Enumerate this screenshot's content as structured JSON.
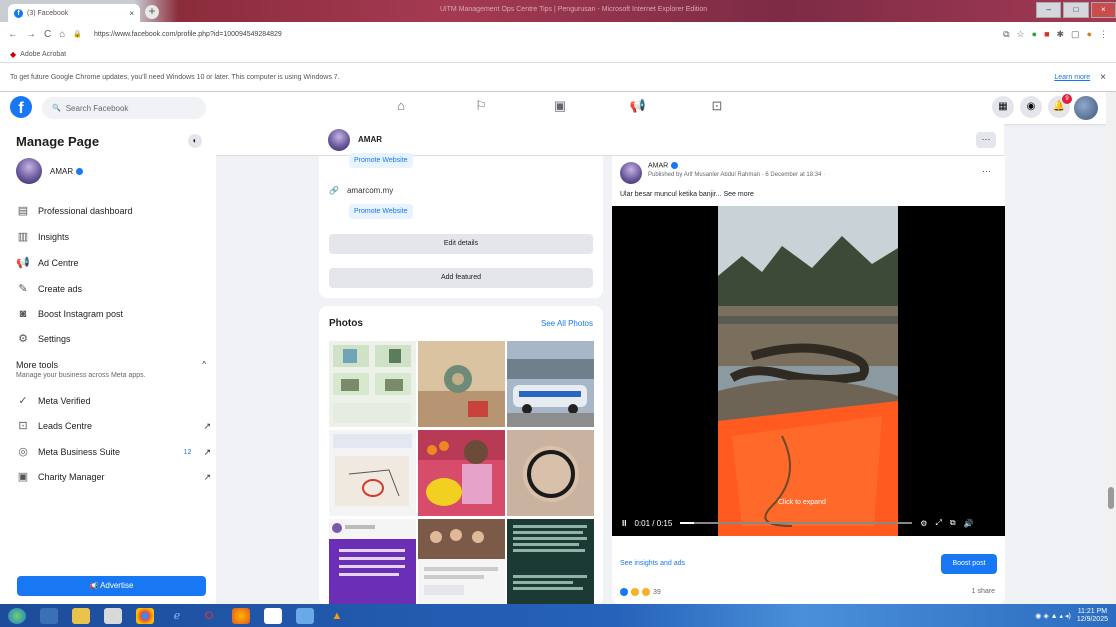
{
  "browser": {
    "tab_title": "(3) Facebook",
    "tab_close": "×",
    "new_tab": "+",
    "window_title": "UiTM Management Ops Centre Tips | Pengurusan - Microsoft Internet Explorer Edition",
    "url": "https://www.facebook.com/profile.php?id=100094549284829",
    "bookmark": "Adobe Acrobat",
    "infobar_text": "To get future Google Chrome updates, you'll need Windows 10 or later. This computer is using Windows 7.",
    "infobar_link": "Learn more",
    "infobar_close": "×",
    "nav": {
      "back": "←",
      "forward": "→",
      "reload": "C",
      "home": "⌂",
      "lock": "🔒"
    },
    "ext_icons": [
      "⧉",
      "☆",
      "●",
      "■",
      "✱",
      "▢",
      "●",
      "⋮"
    ],
    "win_controls": [
      "–",
      "□",
      "×"
    ]
  },
  "fb_header": {
    "logo": "f",
    "search_placeholder": "Search Facebook",
    "search_icon": "🔍",
    "nav_icons": [
      "⌂",
      "⚐",
      "▣",
      "📢",
      "⊡"
    ],
    "right_icons": [
      "▦",
      "◉",
      "🔔"
    ],
    "notif_count": "9"
  },
  "sidebar": {
    "title": "Manage Page",
    "page_name": "AMAR",
    "items": [
      {
        "icon": "▤",
        "label": "Professional dashboard"
      },
      {
        "icon": "▥",
        "label": "Insights"
      },
      {
        "icon": "📢",
        "label": "Ad Centre"
      },
      {
        "icon": "✎",
        "label": "Create ads"
      },
      {
        "icon": "◙",
        "label": "Boost Instagram post"
      },
      {
        "icon": "⚙",
        "label": "Settings"
      }
    ],
    "more_tools_title": "More tools",
    "more_tools_sub": "Manage your business across Meta apps.",
    "more_tools_caret": "^",
    "tools": [
      {
        "icon": "✓",
        "label": "Meta Verified",
        "badge": "",
        "arrow": ""
      },
      {
        "icon": "⊡",
        "label": "Leads Centre",
        "badge": "",
        "arrow": "↗"
      },
      {
        "icon": "◎",
        "label": "Meta Business Suite",
        "badge": "12",
        "arrow": "↗"
      },
      {
        "icon": "▣",
        "label": "Charity Manager",
        "badge": "",
        "arrow": "↗"
      }
    ],
    "advertise_label": "Advertise",
    "advertise_icon": "📢"
  },
  "page_bar": {
    "name": "AMAR",
    "more": "···"
  },
  "intro": {
    "promote_1": "Promote Website",
    "website_icon": "🔗",
    "website": "amarcom.my",
    "promote_2": "Promote Website",
    "edit_details": "Edit details",
    "add_featured": "Add featured"
  },
  "photos": {
    "title": "Photos",
    "see_all": "See All Photos"
  },
  "post": {
    "author": "AMAR",
    "published_by": "Published by Arif Musanler Abdul Rahman · 6 December at 18:34 ·",
    "dots": "···",
    "text": "Ular besar muncul ketika banjir... See more",
    "video_time": "0:01 / 0:15",
    "click_expand": "Click to expand",
    "pause": "II",
    "ctrl_icons": [
      "⚙",
      "⤢",
      "⧉",
      "🔊"
    ],
    "insights_link": "See insights and ads",
    "boost_label": "Boost post",
    "reaction_count": "39",
    "shares": "1 share"
  },
  "taskbar": {
    "clock_time": "11:21 PM",
    "clock_date": "12/9/2025"
  },
  "colors": {
    "fb_blue": "#1877f2",
    "bg": "#f0f2f5"
  }
}
